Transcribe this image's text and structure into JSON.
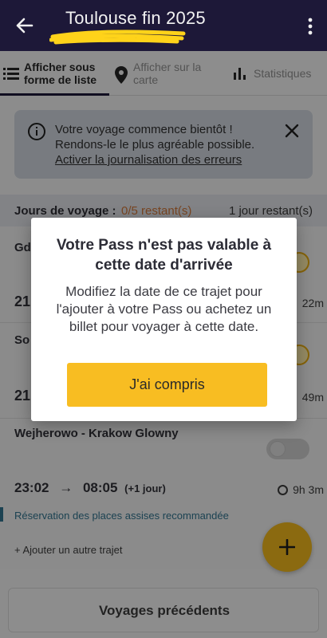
{
  "header": {
    "title": "Toulouse fin 2025",
    "back_icon": "arrow-left-icon",
    "menu_icon": "kebab-menu-icon",
    "redaction_color": "#ffd31a"
  },
  "tabs": [
    {
      "label": "Afficher sous forme de liste",
      "icon": "list-icon",
      "active": true
    },
    {
      "label": "Afficher sur la carte",
      "icon": "map-pin-icon",
      "active": false
    },
    {
      "label": "Statistiques",
      "icon": "bar-chart-icon",
      "active": false
    }
  ],
  "banner": {
    "line1": "Votre voyage commence bientôt !",
    "line2": "Rendons-le le plus agréable possible.",
    "link": "Activer la journalisation des erreurs"
  },
  "days": {
    "label": "Jours de voyage :",
    "remaining": "0/5 restant(s)",
    "right": "1 jour restant(s)"
  },
  "trips": [
    {
      "route": "Gd",
      "dep": "21",
      "duration": "22m"
    },
    {
      "route": "So",
      "dep": "21",
      "duration": "49m"
    },
    {
      "route": "Wejherowo - Krakow Glowny",
      "dep": "23:02",
      "arr": "08:05",
      "next_day": "(+1 jour)",
      "duration": "9h  3m"
    }
  ],
  "reservation": "Réservation des places assises recommandée",
  "add_trip": "+ Ajouter un autre trajet",
  "previous_trips": "Voyages précédents",
  "dialog": {
    "title": "Votre Pass n'est pas valable à cette date d'arrivée",
    "body": "Modifiez la date de ce trajet pour l'ajouter à votre Pass ou achetez un billet pour voyager à cette date.",
    "button": "J'ai compris"
  },
  "colors": {
    "header_bg": "#1d1838",
    "accent_yellow": "#f8bd22",
    "remaining_orange": "#c9743a",
    "reservation_teal": "#2f6f89"
  }
}
